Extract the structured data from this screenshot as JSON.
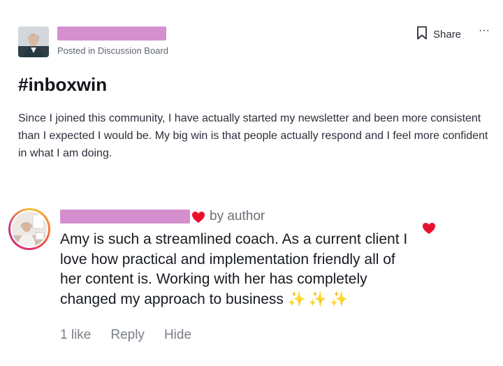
{
  "post": {
    "meta": "Posted in Discussion Board",
    "share_label": "Share",
    "more_label": "···",
    "title": "#inboxwin",
    "body": "Since I joined this community, I have actually started my newsletter and been more consistent than I expected I would be. My big win is that people actually respond and I feel more confident in what I am doing."
  },
  "comment": {
    "badge": "by author",
    "text": "Amy is such a streamlined coach. As a current client I love how practical and implementation friendly all of her content is. Working with her has completely changed my approach to business",
    "emoji": "✨✨✨",
    "likes_label": "1 like",
    "reply_label": "Reply",
    "hide_label": "Hide"
  },
  "colors": {
    "redaction": "#d58fcf",
    "heart": "#e8112d",
    "sparkle": "#f3c43a"
  },
  "icons": {
    "bookmark": "bookmark-icon",
    "more": "more-horizontal-icon",
    "heart": "heart-icon"
  }
}
